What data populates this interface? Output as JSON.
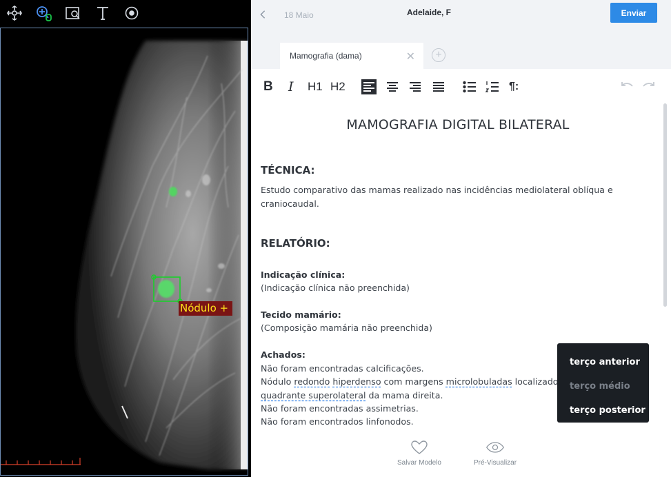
{
  "viewer": {
    "tools": [
      "move-arrows-icon",
      "zoom-in-icon",
      "magnifier-icon",
      "text-tool-icon",
      "target-icon"
    ],
    "annotation_label": "Nódulo +",
    "colors": {
      "annotation_box": "#19d12a",
      "label_bg": "#7a1414",
      "label_text": "#ffe21a"
    }
  },
  "header": {
    "date": "18 Maio",
    "patient": "Adelaide, F",
    "send_label": "Enviar"
  },
  "tabs": [
    {
      "label": "Mamografia (dama)"
    }
  ],
  "toolbar": {
    "bold": "B",
    "italic": "I",
    "h1": "H1",
    "h2": "H2",
    "paragraph": "¶:"
  },
  "doc": {
    "title": "MAMOGRAFIA DIGITAL BILATERAL",
    "tecnica_heading": "TÉCNICA:",
    "tecnica_text_1": "Estudo comparativo das mamas realizado nas incidências mediolateral oblíqua e",
    "tecnica_text_2": "craniocaudal.",
    "relatorio_heading": "RELATÓRIO:",
    "indicacao_label": "Indicação clínica:",
    "indicacao_value": "(Indicação clínica não preenchida)",
    "tecido_label": "Tecido mamário:",
    "tecido_value": "(Composição mamária não preenchida)",
    "achados_label": "Achados:",
    "achados_1": "Não foram encontradas calcificações.",
    "achados_2a": "Nódulo ",
    "achados_2b": "redondo",
    "achados_2c": " ",
    "achados_2d": "hiperdenso",
    "achados_2e": " com margens ",
    "achados_2f": "microlobuladas",
    "achados_2g": " localizado n",
    "achados_3a": "quadrante superolateral",
    "achados_3b": " da mama direita.",
    "achados_4": "Não foram encontradas assimetrias.",
    "achados_5": "Não foram encontrados linfonodos."
  },
  "dropdown": {
    "options": [
      "terço anterior",
      "terço médio",
      "terço posterior"
    ],
    "highlighted": "terço médio"
  },
  "actions": {
    "save_model": "Salvar Modelo",
    "preview": "Pré-Visualizar"
  },
  "colors": {
    "accent": "#2d8ae6",
    "topbar_bg": "#f1f3f6",
    "text": "#3d434b",
    "spell_underline": "#3a86e8"
  }
}
